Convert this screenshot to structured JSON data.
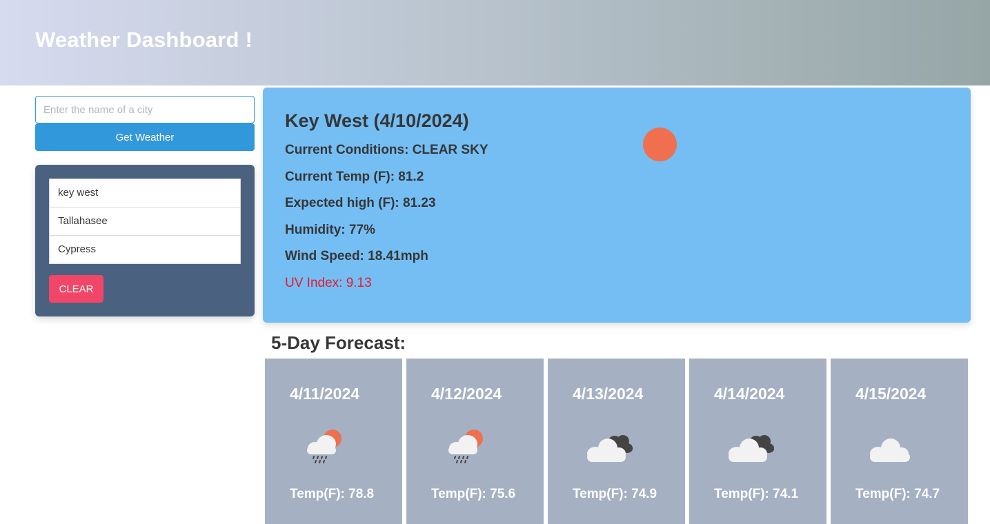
{
  "header": {
    "title": "Weather Dashboard !"
  },
  "search": {
    "placeholder": "Enter the name of a city",
    "value": "",
    "button_label": "Get Weather"
  },
  "history": {
    "items": [
      "key west",
      "Tallahasee",
      "Cypress"
    ],
    "clear_label": "CLEAR"
  },
  "current": {
    "title": "Key West (4/10/2024)",
    "conditions": "Current Conditions: CLEAR SKY",
    "temp": "Current Temp (F): 81.2",
    "high": "Expected high (F): 81.23",
    "humidity": "Humidity: 77%",
    "wind": "Wind Speed: 18.41mph",
    "uv": "UV Index: 9.13",
    "icon": "clear-sky-sun-icon",
    "colors": {
      "panel": "#74bef4",
      "uv": "#e8192c",
      "sun": "#ef6f4e"
    }
  },
  "forecast": {
    "title": "5-Day Forecast:",
    "days": [
      {
        "date": "4/11/2024",
        "icon": "rain-sun-icon",
        "temp": "Temp(F): 78.8"
      },
      {
        "date": "4/12/2024",
        "icon": "rain-sun-icon",
        "temp": "Temp(F): 75.6"
      },
      {
        "date": "4/13/2024",
        "icon": "broken-clouds-icon",
        "temp": "Temp(F): 74.9"
      },
      {
        "date": "4/14/2024",
        "icon": "broken-clouds-icon",
        "temp": "Temp(F): 74.1"
      },
      {
        "date": "4/15/2024",
        "icon": "cloud-icon",
        "temp": "Temp(F): 74.7"
      }
    ]
  }
}
